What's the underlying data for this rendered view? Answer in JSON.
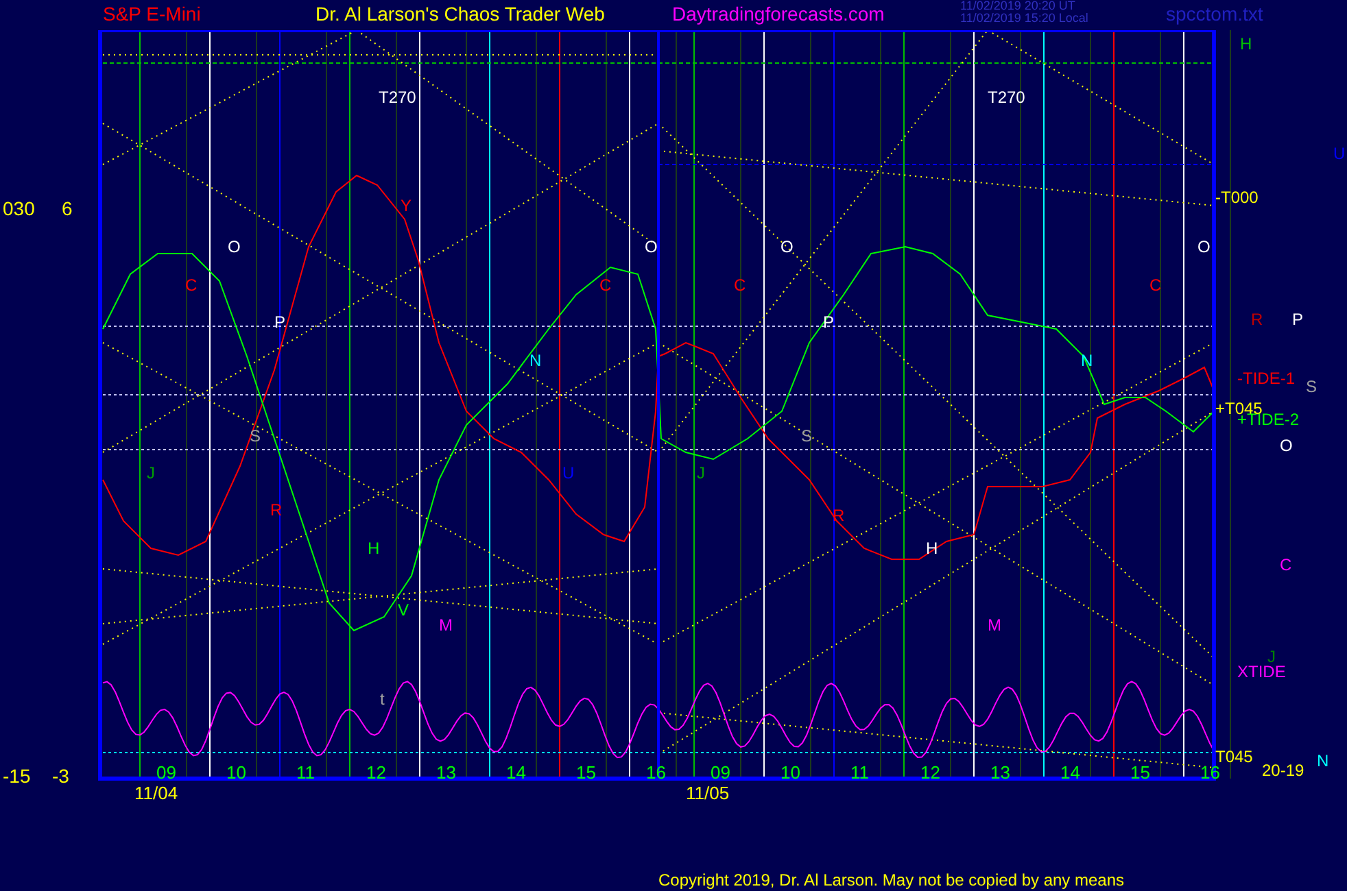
{
  "header": {
    "symbol": "S&P E-Mini",
    "title": "Dr. Al Larson's Chaos Trader Web",
    "site": "Daytradingforecasts.com",
    "timestamps": [
      "11/02/2019 20:20 UT",
      "11/02/2019 15:20 Local"
    ],
    "file": "spcctom.txt"
  },
  "y_axis_labels": [
    "030",
    "6",
    "-15",
    "-3"
  ],
  "panels": [
    {
      "date": "11/04",
      "marker": "T270",
      "hours": [
        "09",
        "10",
        "11",
        "12",
        "13",
        "14",
        "15",
        "16"
      ]
    },
    {
      "date": "11/05",
      "marker": "T270",
      "hours": [
        "09",
        "10",
        "11",
        "12",
        "13",
        "14",
        "15",
        "16"
      ]
    }
  ],
  "plot_labels": [
    {
      "text": "O",
      "color": "#ffffff"
    },
    {
      "text": "C",
      "color": "#ff0000"
    },
    {
      "text": "P",
      "color": "#ffffff"
    },
    {
      "text": "S",
      "color": "#a0a0a0"
    },
    {
      "text": "J",
      "color": "#00a000"
    },
    {
      "text": "R",
      "color": "#ff0000"
    },
    {
      "text": "H",
      "color": "#00ff00"
    },
    {
      "text": "V",
      "color": "#00ff00"
    },
    {
      "text": "M",
      "color": "#ff00ff"
    },
    {
      "text": "t",
      "color": "#a0a0a0"
    },
    {
      "text": "Y",
      "color": "#ff0000"
    },
    {
      "text": "N",
      "color": "#00ffff"
    },
    {
      "text": "U",
      "color": "#0000ff"
    },
    {
      "text": "C",
      "color": "#ff0000"
    },
    {
      "text": "O",
      "color": "#ffffff"
    },
    {
      "text": "C",
      "color": "#ff0000"
    },
    {
      "text": "O",
      "color": "#ffffff"
    },
    {
      "text": "P",
      "color": "#ffffff"
    },
    {
      "text": "S",
      "color": "#a0a0a0"
    },
    {
      "text": "J",
      "color": "#00a000"
    },
    {
      "text": "R",
      "color": "#ff0000"
    },
    {
      "text": "H",
      "color": "#ffffff"
    },
    {
      "text": "M",
      "color": "#ff00ff"
    },
    {
      "text": "N",
      "color": "#00ffff"
    },
    {
      "text": "C",
      "color": "#ff0000"
    },
    {
      "text": "O",
      "color": "#ffffff"
    }
  ],
  "right_labels": [
    {
      "text": "H",
      "color": "#00c000"
    },
    {
      "text": "U",
      "color": "#0000ff"
    },
    {
      "text": "-T000",
      "color": "#ffff00"
    },
    {
      "text": "R",
      "color": "#c00000"
    },
    {
      "text": "P",
      "color": "#ffffff"
    },
    {
      "text": "-TIDE-1",
      "color": "#ff0000"
    },
    {
      "text": "S",
      "color": "#a0a0a0"
    },
    {
      "text": "+T045",
      "color": "#ffff00"
    },
    {
      "text": "+TIDE-2",
      "color": "#00ff00"
    },
    {
      "text": "O",
      "color": "#ffffff"
    },
    {
      "text": "C",
      "color": "#ff00ff"
    },
    {
      "text": "J",
      "color": "#008000"
    },
    {
      "text": "XTIDE",
      "color": "#ff00ff"
    },
    {
      "text": "T045",
      "color": "#ffff00"
    },
    {
      "text": "20-19",
      "color": "#ffff00"
    },
    {
      "text": "N",
      "color": "#00ffff"
    }
  ],
  "copyright": "Copyright 2019, Dr. Al Larson. May not be copied by any means"
}
